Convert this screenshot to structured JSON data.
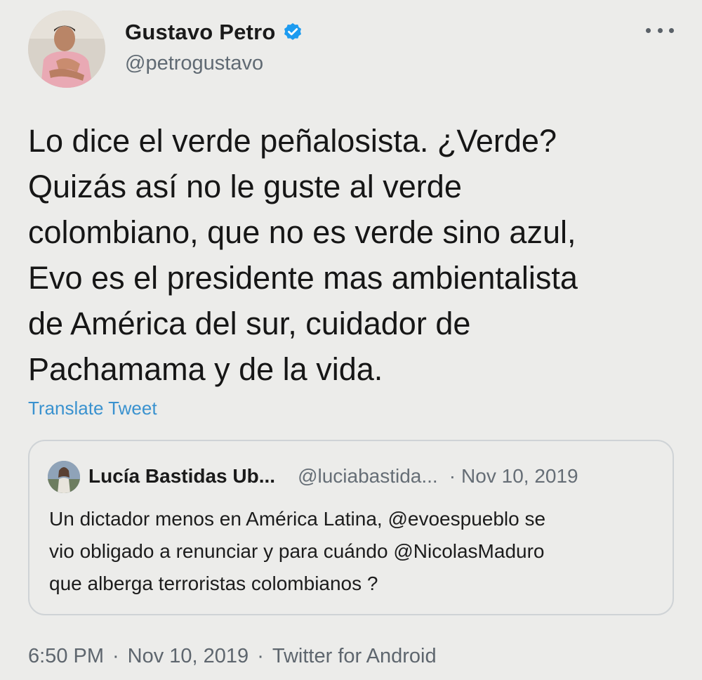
{
  "author": {
    "name": "Gustavo Petro",
    "handle": "@petrogustavo",
    "verified": true
  },
  "tweet": {
    "lines": [
      "Lo dice el verde peñalosista. ¿Verde?",
      "Quizás así no le guste al verde",
      "colombiano, que no es verde sino azul,",
      "Evo es el presidente mas ambientalista",
      "de América del sur, cuidador de",
      "Pachamama y de la vida."
    ],
    "translate_label": "Translate Tweet"
  },
  "quoted": {
    "name": "Lucía Bastidas Ub...",
    "handle": "@luciabastida...",
    "separator": "·",
    "date": "Nov 10, 2019",
    "lines": [
      "Un dictador menos en América Latina, @evoespueblo se",
      "vio obligado a renunciar y para cuándo @NicolasMaduro",
      "que alberga terroristas colombianos ?"
    ]
  },
  "meta": {
    "time": "6:50 PM",
    "date": "Nov 10, 2019",
    "source": "Twitter for Android",
    "separator": "·"
  },
  "colors": {
    "background": "#ececea",
    "link": "#3a92cf",
    "verified": "#1d9bf0",
    "secondary_text": "#606a73"
  },
  "icons": {
    "verified": "verified-badge-icon",
    "more": "more-options-icon"
  }
}
